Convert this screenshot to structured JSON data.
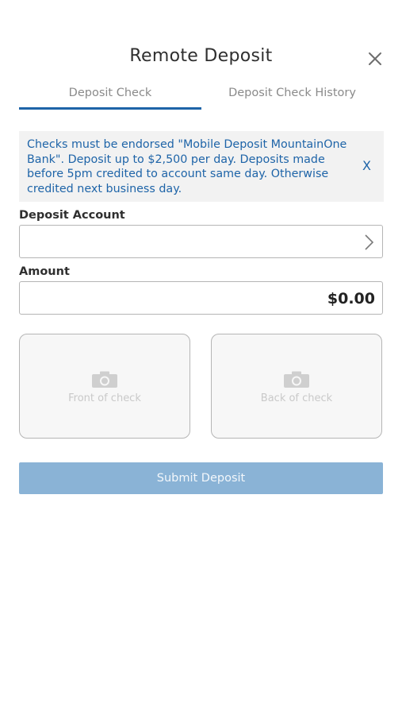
{
  "header": {
    "title": "Remote Deposit",
    "close_icon": "close-icon"
  },
  "tabs": [
    {
      "label": "Deposit Check",
      "active": true
    },
    {
      "label": "Deposit Check History",
      "active": false
    }
  ],
  "notice": {
    "text": "Checks must be endorsed \"Mobile Deposit MountainOne Bank\". Deposit up to $2,500 per day. Deposits made before 5pm credited to account same day. Otherwise credited next business day.",
    "dismiss_label": "X"
  },
  "form": {
    "deposit_account_label": "Deposit Account",
    "deposit_account_value": "",
    "amount_label": "Amount",
    "amount_value": "$0.00"
  },
  "check_images": {
    "front_label": "Front of check",
    "back_label": "Back of check"
  },
  "submit_label": "Submit Deposit",
  "colors": {
    "accent": "#1e64a8",
    "submit_disabled": "#8ab3d6",
    "notice_bg": "#f2f2f2"
  }
}
